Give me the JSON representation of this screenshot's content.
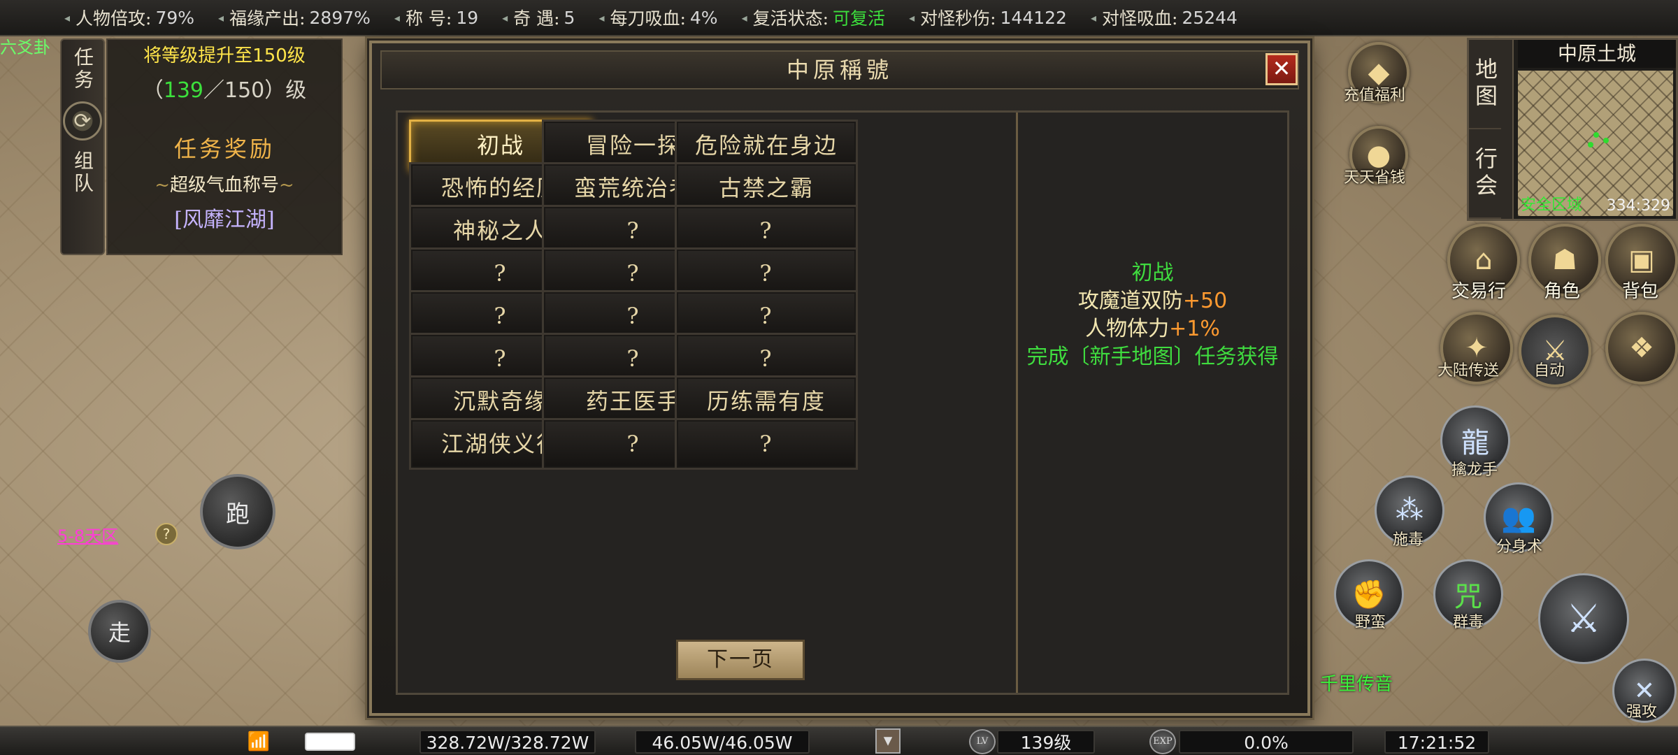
{
  "top_stats": [
    {
      "key": "人物倍攻:",
      "value": "79%",
      "highlight": false
    },
    {
      "key": "福缘产出:",
      "value": "2897%",
      "highlight": false
    },
    {
      "key": "称 号:",
      "value": "19",
      "highlight": false
    },
    {
      "key": "奇 遇:",
      "value": "5",
      "highlight": false
    },
    {
      "key": "每刀吸血:",
      "value": "4%",
      "highlight": false
    },
    {
      "key": "复活状态:",
      "value": "可复活",
      "highlight": true
    },
    {
      "key": "对怪秒伤:",
      "value": "144122",
      "highlight": false
    },
    {
      "key": "对怪吸血:",
      "value": "25244",
      "highlight": false
    }
  ],
  "edge_text": "六爻卦",
  "quest": {
    "tab_top": "任务",
    "tab_bottom": "组队",
    "goal": "将等级提升至150级",
    "progress_open": "（",
    "progress_current": "139",
    "progress_rest": "／150）级",
    "reward_title": "任务奖励",
    "reward_name": "超级气血称号",
    "reward_item": "[风靡江湖]"
  },
  "dialog": {
    "title": "中原稱號",
    "close": "✕",
    "titles": [
      {
        "label": "初战",
        "selected": true
      },
      {
        "label": "冒险一探",
        "selected": false
      },
      {
        "label": "危险就在身边",
        "selected": false
      },
      {
        "label": "恐怖的经历",
        "selected": false
      },
      {
        "label": "蛮荒统治者",
        "selected": false
      },
      {
        "label": "古禁之霸",
        "selected": false
      },
      {
        "label": "神秘之人",
        "selected": false
      },
      {
        "label": "?",
        "selected": false
      },
      {
        "label": "?",
        "selected": false
      },
      {
        "label": "?",
        "selected": false
      },
      {
        "label": "?",
        "selected": false
      },
      {
        "label": "?",
        "selected": false
      },
      {
        "label": "?",
        "selected": false
      },
      {
        "label": "?",
        "selected": false
      },
      {
        "label": "?",
        "selected": false
      },
      {
        "label": "?",
        "selected": false
      },
      {
        "label": "?",
        "selected": false
      },
      {
        "label": "?",
        "selected": false
      },
      {
        "label": "沉默奇缘",
        "selected": false
      },
      {
        "label": "药王医手",
        "selected": false
      },
      {
        "label": "历练需有度",
        "selected": false
      },
      {
        "label": "江湖侠义行",
        "selected": false
      },
      {
        "label": "?",
        "selected": false
      },
      {
        "label": "?",
        "selected": false
      }
    ],
    "next_page": "下一页",
    "detail": {
      "name": "初战",
      "stat1_label": "攻魔道双防",
      "stat1_value": "+50",
      "stat2_label": "人物体力",
      "stat2_value": "+1%",
      "source": "完成〔新手地图〕任务获得"
    }
  },
  "map": {
    "tab_map": "地图",
    "tab_guild": "行会",
    "name": "中原土城",
    "zone": "安全区域",
    "coords": "334:329"
  },
  "hud": {
    "recharge": "充值福利",
    "daily": "天天省钱",
    "trade": "交易行",
    "character": "角色",
    "bag": "背包",
    "teleport": "大陆传送",
    "auto": "自动",
    "thousand_li": "千里传音",
    "attack": "强攻",
    "skills": [
      "擒龙手",
      "施毒",
      "分身术",
      "野蛮",
      "群毒"
    ],
    "run": "跑",
    "walk": "走",
    "zone_label": "5-8天区",
    "help": "?"
  },
  "bottom": {
    "hp": "328.72W/328.72W",
    "mp": "46.05W/46.05W",
    "lv_icon": "LV",
    "level": "139级",
    "exp_icon": "EXP",
    "exp": "0.0%",
    "time": "17:21:52"
  },
  "colors": {
    "accent_gold": "#e4b245",
    "green_text": "#3fdc3f",
    "orange_value": "#ff9a30",
    "close_red": "#b42a1c"
  }
}
